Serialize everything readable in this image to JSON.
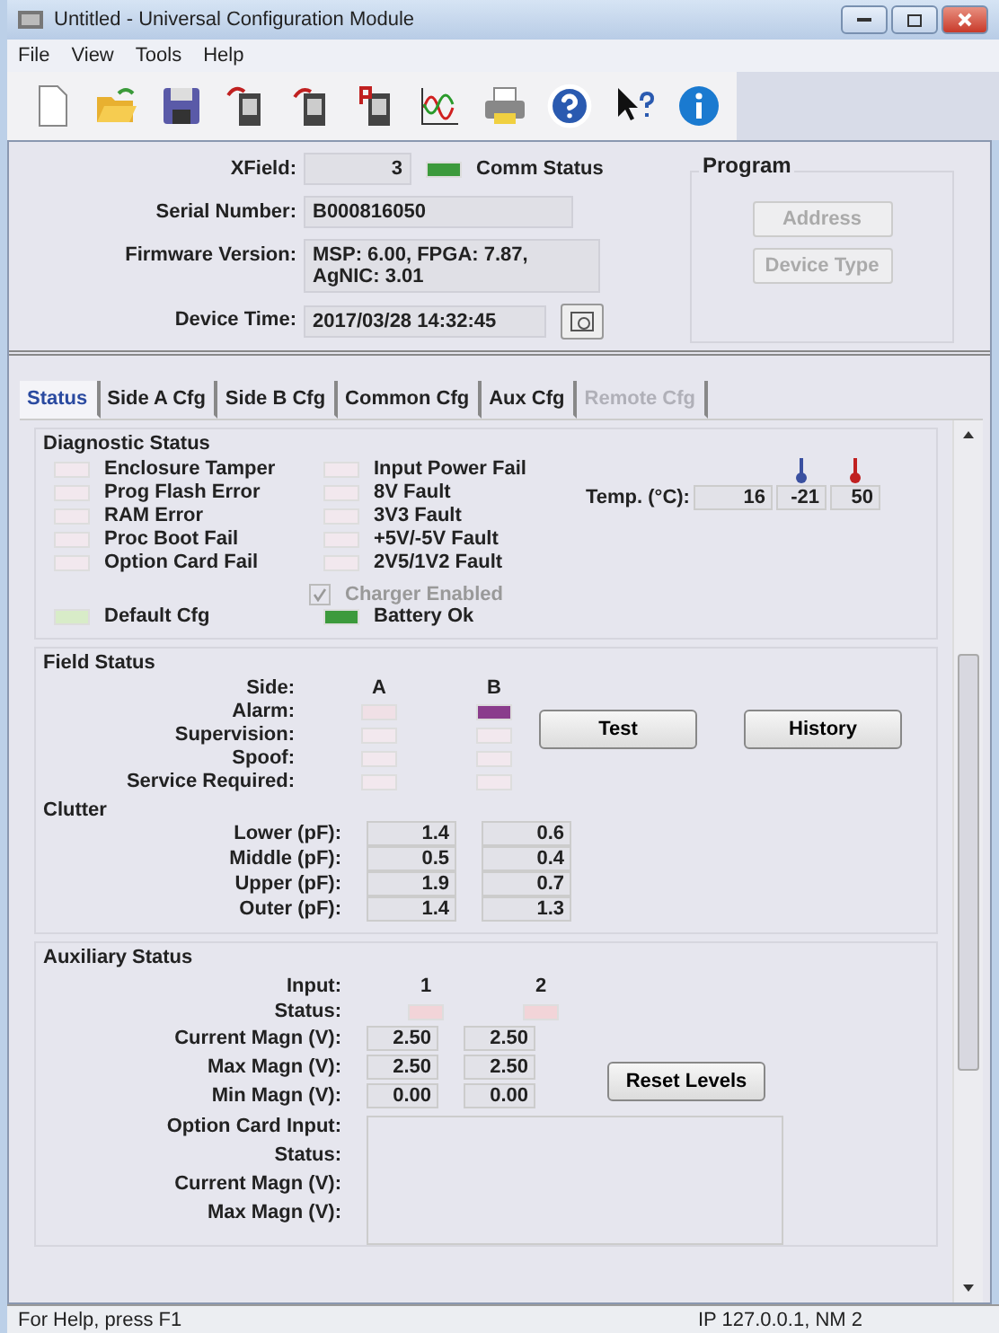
{
  "window": {
    "title": "Untitled - Universal Configuration Module"
  },
  "menu": [
    "File",
    "View",
    "Tools",
    "Help"
  ],
  "toolbar": [
    {
      "kind": "new"
    },
    {
      "kind": "open"
    },
    {
      "kind": "save"
    },
    {
      "kind": "upload"
    },
    {
      "kind": "download"
    },
    {
      "kind": "device"
    },
    {
      "kind": "wave"
    },
    {
      "kind": "print"
    },
    {
      "kind": "help"
    },
    {
      "kind": "whatsthis"
    },
    {
      "kind": "info"
    }
  ],
  "header": {
    "xfield_label": "XField:",
    "xfield": "3",
    "comm_status": {
      "label": "Comm Status",
      "color": "#3c9a3c"
    },
    "serial_label": "Serial Number:",
    "serial": "B000816050",
    "firmware_label": "Firmware Version:",
    "firmware": "MSP: 6.00, FPGA: 7.87, AgNIC: 3.01",
    "time_label": "Device Time:",
    "time": "2017/03/28 14:32:45",
    "program": {
      "title": "Program",
      "buttons": [
        {
          "label": "Address",
          "disabled": true
        },
        {
          "label": "Device Type",
          "disabled": true
        }
      ]
    }
  },
  "tabs": [
    {
      "label": "Status",
      "selected": true,
      "disabled": false
    },
    {
      "label": "Side A Cfg",
      "selected": false,
      "disabled": false
    },
    {
      "label": "Side B Cfg",
      "selected": false,
      "disabled": false
    },
    {
      "label": "Common Cfg",
      "selected": false,
      "disabled": false
    },
    {
      "label": "Aux Cfg",
      "selected": false,
      "disabled": false
    },
    {
      "label": "Remote Cfg",
      "selected": false,
      "disabled": true
    }
  ],
  "diagnostic": {
    "title": "Diagnostic Status",
    "column_1": [
      {
        "label": "Enclosure Tamper",
        "color": "#f2e8ee"
      },
      {
        "label": "Prog Flash Error",
        "color": "#f2e8ee"
      },
      {
        "label": "RAM Error",
        "color": "#f2e8ee"
      },
      {
        "label": "Proc Boot Fail",
        "color": "#f2e8ee"
      },
      {
        "label": "Option Card Fail",
        "color": "#f2e8ee"
      }
    ],
    "column_2": [
      {
        "label": "Input Power Fail",
        "color": "#f2e8ee"
      },
      {
        "label": "8V Fault",
        "color": "#f2e8ee"
      },
      {
        "label": "3V3 Fault",
        "color": "#f2e8ee"
      },
      {
        "label": "+5V/-5V Fault",
        "color": "#f2e8ee"
      },
      {
        "label": "2V5/1V2 Fault",
        "color": "#f2e8ee"
      }
    ],
    "temp_label": "Temp. (°C):",
    "temps": [
      "16",
      "-21",
      "50"
    ],
    "charger": {
      "label": "Charger Enabled",
      "checked": true,
      "disabled": true
    },
    "default_cfg": {
      "label": "Default Cfg",
      "color": "#d8ecc8"
    },
    "battery": {
      "label": "Battery Ok",
      "color": "#3c9a3c"
    }
  },
  "field": {
    "title": "Field Status",
    "side_label": "Side:",
    "sides": [
      "A",
      "B"
    ],
    "rows": [
      {
        "label": "Alarm:",
        "leds": [
          {
            "color": "#f0e0e6"
          },
          {
            "color": "#8a3c8c"
          }
        ]
      },
      {
        "label": "Supervision:",
        "leds": [
          {
            "color": "#f2e8ee"
          },
          {
            "color": "#f2e8ee"
          }
        ]
      },
      {
        "label": "Spoof:",
        "leds": [
          {
            "color": "#f2e8ee"
          },
          {
            "color": "#f2e8ee"
          }
        ]
      },
      {
        "label": "Service Required:",
        "leds": [
          {
            "color": "#f2e8ee"
          },
          {
            "color": "#f2e8ee"
          }
        ]
      }
    ],
    "buttons": [
      "Test",
      "History"
    ],
    "clutter_title": "Clutter",
    "clutter": [
      {
        "label": "Lower (pF):",
        "values": [
          "1.4",
          "0.6"
        ]
      },
      {
        "label": "Middle (pF):",
        "values": [
          "0.5",
          "0.4"
        ]
      },
      {
        "label": "Upper (pF):",
        "values": [
          "1.9",
          "0.7"
        ]
      },
      {
        "label": "Outer (pF):",
        "values": [
          "1.4",
          "1.3"
        ]
      }
    ]
  },
  "aux": {
    "title": "Auxiliary Status",
    "input_label": "Input:",
    "inputs": [
      "1",
      "2"
    ],
    "status_label": "Status:",
    "status": [
      {
        "color": "#f2d4d8"
      },
      {
        "color": "#f2d4d8"
      }
    ],
    "rows": [
      {
        "label": "Current Magn (V):",
        "values": [
          "2.50",
          "2.50"
        ]
      },
      {
        "label": "Max Magn (V):",
        "values": [
          "2.50",
          "2.50"
        ]
      },
      {
        "label": "Min Magn (V):",
        "values": [
          "0.00",
          "0.00"
        ]
      }
    ],
    "reset_button": "Reset Levels",
    "option_card_label": "Option Card Input:",
    "option_rows": [
      "Status:",
      "Current Magn (V):",
      "Max Magn (V):"
    ]
  },
  "status_bar": {
    "help": "For Help, press F1",
    "ip": "IP 127.0.0.1, NM 2"
  }
}
